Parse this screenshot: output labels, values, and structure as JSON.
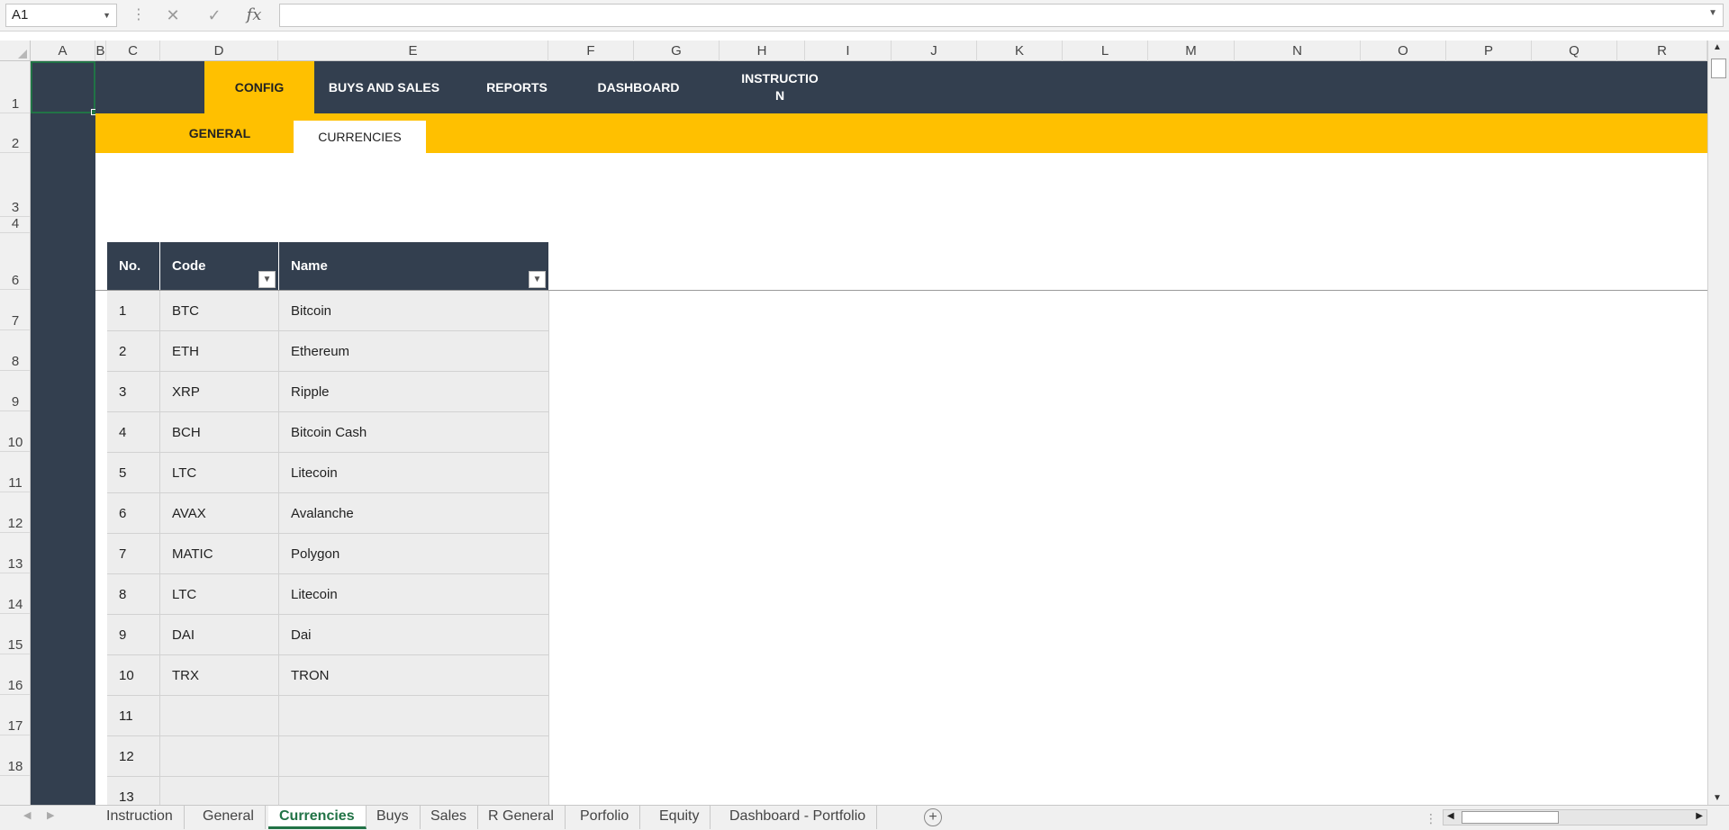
{
  "formula_bar": {
    "name_box": "A1",
    "fx_label": "fx",
    "cancel_glyph": "✕",
    "enter_glyph": "✓",
    "formula_value": ""
  },
  "columns": [
    "A",
    "B",
    "C",
    "D",
    "E",
    "F",
    "G",
    "H",
    "I",
    "J",
    "K",
    "L",
    "M",
    "N",
    "O",
    "P",
    "Q",
    "R"
  ],
  "rows": [
    "1",
    "2",
    "3",
    "4",
    "6",
    "7",
    "8",
    "9",
    "10",
    "11",
    "12",
    "13",
    "14",
    "15",
    "16",
    "17",
    "18"
  ],
  "nav_tabs": [
    "CONFIG",
    "BUYS AND SALES",
    "REPORTS",
    "DASHBOARD",
    "INSTRUCTIO N"
  ],
  "sub_tabs": [
    "GENERAL",
    "CURRENCIES"
  ],
  "table": {
    "headers": [
      "No.",
      "Code",
      "Name"
    ],
    "rows": [
      [
        "1",
        "BTC",
        "Bitcoin"
      ],
      [
        "2",
        "ETH",
        "Ethereum"
      ],
      [
        "3",
        "XRP",
        "Ripple"
      ],
      [
        "4",
        "BCH",
        "Bitcoin Cash"
      ],
      [
        "5",
        "LTC",
        "Litecoin"
      ],
      [
        "6",
        "AVAX",
        "Avalanche"
      ],
      [
        "7",
        "MATIC",
        "Polygon"
      ],
      [
        "8",
        "LTC",
        "Litecoin"
      ],
      [
        "9",
        "DAI",
        "Dai"
      ],
      [
        "10",
        "TRX",
        "TRON"
      ],
      [
        "11",
        "",
        ""
      ],
      [
        "12",
        "",
        ""
      ],
      [
        "13",
        "",
        ""
      ]
    ]
  },
  "sheet_tabs": [
    "Instruction",
    "General",
    "Currencies",
    "Buys",
    "Sales",
    "R General",
    "Porfolio",
    "Equity",
    "Dashboard - Portfolio"
  ],
  "active_sheet": "Currencies",
  "colors": {
    "nav_dark": "#333f4f",
    "accent_yellow": "#ffc000",
    "excel_green": "#217346",
    "table_cell": "#ededed"
  },
  "icons": {
    "namebox_dropdown": "chevron-down-icon",
    "formula_dropdown": "chevron-down-icon",
    "filter": "filter-dropdown-icon",
    "add_sheet": "plus-circle-icon",
    "scroll_up": "arrow-up-icon",
    "scroll_down": "arrow-down-icon"
  }
}
